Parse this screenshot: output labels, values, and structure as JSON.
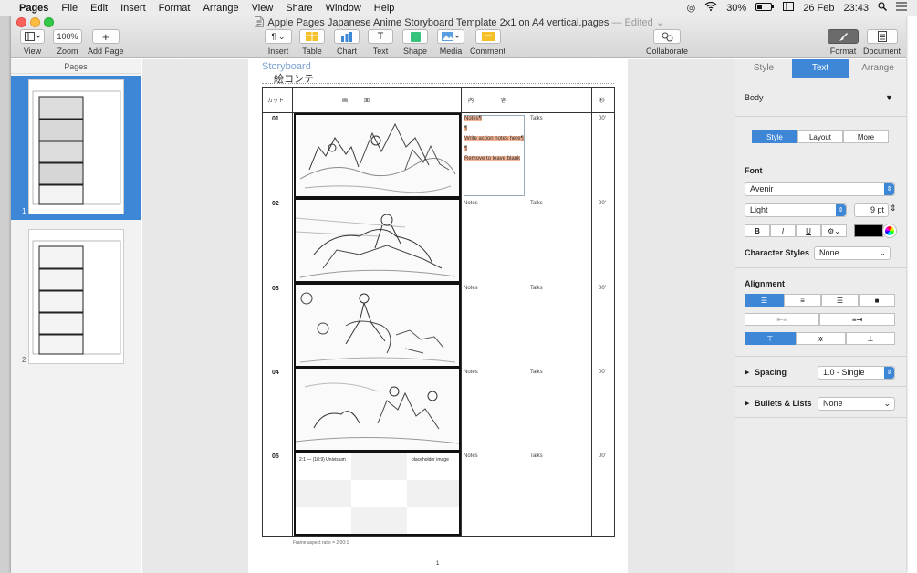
{
  "menubar": {
    "apple": "",
    "app": "Pages",
    "items": [
      "File",
      "Edit",
      "Insert",
      "Format",
      "Arrange",
      "View",
      "Share",
      "Window",
      "Help"
    ],
    "battery": "30%",
    "date": "26 Feb",
    "time": "23:43"
  },
  "window": {
    "title": "Apple Pages Japanese Anime Storyboard Template 2x1 on A4 vertical.pages",
    "edited": "— Edited ⌄"
  },
  "toolbar": {
    "view": "View",
    "zoom_value": "100%",
    "zoom": "Zoom",
    "add_page": "Add Page",
    "insert": "Insert",
    "table": "Table",
    "chart": "Chart",
    "text": "Text",
    "shape": "Shape",
    "media": "Media",
    "comment": "Comment",
    "collaborate": "Collaborate",
    "format": "Format",
    "document": "Document"
  },
  "pages_panel": {
    "header": "Pages",
    "thumbs": [
      {
        "num": "1"
      },
      {
        "num": "2"
      }
    ]
  },
  "storyboard": {
    "title": "Storyboard",
    "subtitle": "絵コンテ",
    "headers": {
      "cut": "カット",
      "picture": "画　　　面",
      "content": "内　　　　　容",
      "seconds": "秒"
    },
    "rows": [
      {
        "cut": "01",
        "notes": "Notes",
        "talks": "Talks",
        "sec": "00'"
      },
      {
        "cut": "02",
        "notes": "Notes",
        "talks": "Talks",
        "sec": "00'"
      },
      {
        "cut": "03",
        "notes": "Notes",
        "talks": "Talks",
        "sec": "00'"
      },
      {
        "cut": "04",
        "notes": "Notes",
        "talks": "Talks",
        "sec": "00'"
      },
      {
        "cut": "05",
        "notes": "Notes",
        "talks": "Talks",
        "sec": "00'"
      }
    ],
    "selected_notes": [
      "Notes¶",
      "¶",
      "Write action notes here¶",
      "¶",
      "Remove to leave blank"
    ],
    "placeholder_left": "2:1 — (18:9) Univisium",
    "placeholder_right": "placeholder image",
    "frame_note": "Frame aspect ratio = 2.00:1",
    "page_number": "1"
  },
  "inspector": {
    "tabs": [
      "Style",
      "Text",
      "Arrange"
    ],
    "active_tab": "Text",
    "paragraph_style": "Body",
    "subtabs": [
      "Style",
      "Layout",
      "More"
    ],
    "font_label": "Font",
    "font_family": "Avenir",
    "font_weight": "Light",
    "font_size": "9 pt",
    "bold": "B",
    "italic": "I",
    "underline": "U",
    "gear": "⚙︎⌄",
    "char_styles_label": "Character Styles",
    "char_styles_value": "None",
    "alignment_label": "Alignment",
    "spacing_label": "Spacing",
    "spacing_value": "1.0 - Single",
    "bullets_label": "Bullets & Lists",
    "bullets_value": "None",
    "text_color": "#000000"
  },
  "colors": {
    "accent": "#3d87d6",
    "highlight": "#f4b493",
    "title_blue": "#7aa0d0"
  }
}
